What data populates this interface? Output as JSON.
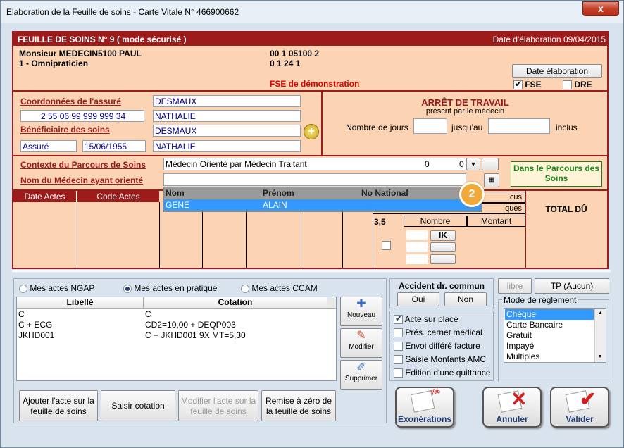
{
  "window": {
    "title": "Elaboration de la Feuille de soins - Carte Vitale N° 466900662",
    "close": "x"
  },
  "header": {
    "title": "FEUILLE DE SOINS  N° 9 ( mode sécurisé )",
    "date": "Date d'élaboration 09/04/2015"
  },
  "doctor": {
    "name": "Monsieur MEDECIN5100 PAUL",
    "specialty": "1 - Omnipraticien",
    "code1": "00 1 05100 2",
    "code2": "0 1 24 1",
    "fse_demo": "FSE de démonstration"
  },
  "date_elab": {
    "button": "Date élaboration",
    "fse": "FSE",
    "dre": "DRE"
  },
  "insured": {
    "coord_label": "Coordonnées de l'assuré",
    "nir": "2 55 06 99 999 999 34",
    "last": "DESMAUX",
    "first": "NATHALIE",
    "benef_label": "Bénéficiaire des soins",
    "benef_last": "DESMAUX",
    "benef_first": "NATHALIE",
    "quality": "Assuré",
    "dob": "15/06/1955"
  },
  "arret": {
    "title": "ARRÊT DE TRAVAIL",
    "subtitle": "prescrit par le médecin",
    "days_label": "Nombre de jours",
    "until_label": "jusqu'au",
    "inclus": "inclus"
  },
  "parcours": {
    "label": "Contexte du Parcours de Soins",
    "value": "Médecin Orienté par Médecin Traitant",
    "n1": "0",
    "n2": "0",
    "medecin_label": "Nom du Médecin ayant orienté",
    "badge": "Dans le Parcours des Soins"
  },
  "dropdown": {
    "columns": [
      "Nom",
      "Prénom",
      "No National"
    ],
    "rows": [
      {
        "nom": "GENE",
        "prenom": "ALAIN",
        "no": ""
      }
    ],
    "badge": "2"
  },
  "actes": {
    "col_date": "Date Actes",
    "col_code": "Code Actes",
    "ik_label": "IK",
    "nombre": "Nombre",
    "montant": "Montant",
    "total": "TOTAL DÛ",
    "val35": "3,5",
    "partial1": "cus",
    "partial2": "ques"
  },
  "filters": {
    "ngap": "Mes actes NGAP",
    "pratique": "Mes actes en pratique",
    "ccam": "Mes actes CCAM"
  },
  "list": {
    "col_libelle": "Libellé",
    "col_cotation": "Cotation",
    "rows": [
      {
        "libelle": "C",
        "cotation": "C"
      },
      {
        "libelle": "C + ECG",
        "cotation": "CD2=10,00 + DEQP003"
      },
      {
        "libelle": "JKHD001",
        "cotation": "C + JKHD001  9X   MT=5,30"
      }
    ]
  },
  "side_buttons": {
    "nouveau": "Nouveau",
    "modifier": "Modifier",
    "supprimer": "Supprimer"
  },
  "bottom_buttons": {
    "ajouter": "Ajouter l'acte sur la feuille de soins",
    "saisir": "Saisir cotation",
    "modifier_acte": "Modifier l'acte sur la feuille de soins",
    "remise": "Remise à zéro de la feuille de soins"
  },
  "accident": {
    "title": "Accident dr. commun",
    "oui": "Oui",
    "non": "Non"
  },
  "checks": {
    "sur_place": "Acte sur place",
    "carnet": "Prés. carnet médical",
    "envoi": "Envoi différé facture",
    "saisie": "Saisie Montants AMC",
    "quittance": "Edition d'une quittance"
  },
  "tp": {
    "libre": "libre",
    "tp": "TP (Aucun)"
  },
  "reglement": {
    "title": "Mode de règlement",
    "options": [
      "Chèque",
      "Carte Bancaire",
      "Gratuit",
      "Impayé",
      "Multiples"
    ]
  },
  "actions": {
    "exonerations": "Exonérations",
    "annuler": "Annuler",
    "valider": "Valider",
    "stamp": "100%"
  }
}
